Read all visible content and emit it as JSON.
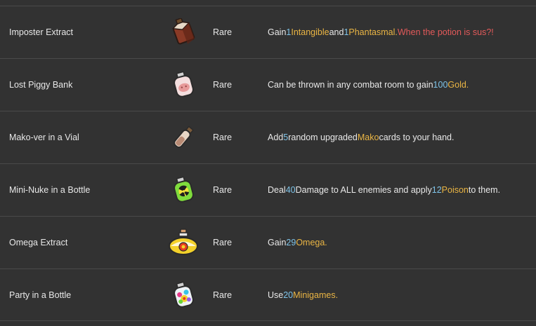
{
  "colors": {
    "background": "#323232",
    "divider": "#4a4a4a",
    "text": "#e8e8e8",
    "number": "#7ec3e8",
    "keyword": "#eab544",
    "flavor": "#e35a5a"
  },
  "potions": [
    {
      "name": "Imposter Extract",
      "icon": "imposter-extract-icon",
      "rarity": "Rare",
      "description": {
        "p1": "Gain ",
        "n1": "1",
        "sp1": " ",
        "k1": "Intangible",
        "p2": " and ",
        "n2": "1",
        "sp2": " ",
        "k2": "Phantasmal.",
        "sp3": " ",
        "flavor": "When the potion is sus?!"
      }
    },
    {
      "name": "Lost Piggy Bank",
      "icon": "piggy-bank-bottle-icon",
      "rarity": "Rare",
      "description": {
        "p1": "Can be thrown in any combat room to gain ",
        "n1": "100",
        "sp1": " ",
        "k1": "Gold."
      }
    },
    {
      "name": "Mako-ver in a Vial",
      "icon": "vial-icon",
      "rarity": "Rare",
      "description": {
        "p1": "Add ",
        "n1": "5",
        "p2": " random upgraded ",
        "k1": "Mako",
        "p3": " cards to your hand."
      }
    },
    {
      "name": "Mini-Nuke in a Bottle",
      "icon": "nuke-bottle-icon",
      "rarity": "Rare",
      "description": {
        "p1": "Deal ",
        "n1": "40",
        "p2": " Damage to ALL enemies and apply ",
        "n2": "12",
        "sp1": " ",
        "k1": "Poison",
        "p3": " to them."
      }
    },
    {
      "name": "Omega Extract",
      "icon": "omega-flask-icon",
      "rarity": "Rare",
      "description": {
        "p1": "Gain ",
        "n1": "29",
        "sp1": " ",
        "k1": "Omega."
      }
    },
    {
      "name": "Party in a Bottle",
      "icon": "party-bottle-icon",
      "rarity": "Rare",
      "description": {
        "p1": "Use ",
        "n1": "20",
        "sp1": " ",
        "k1": "Minigames."
      }
    }
  ]
}
